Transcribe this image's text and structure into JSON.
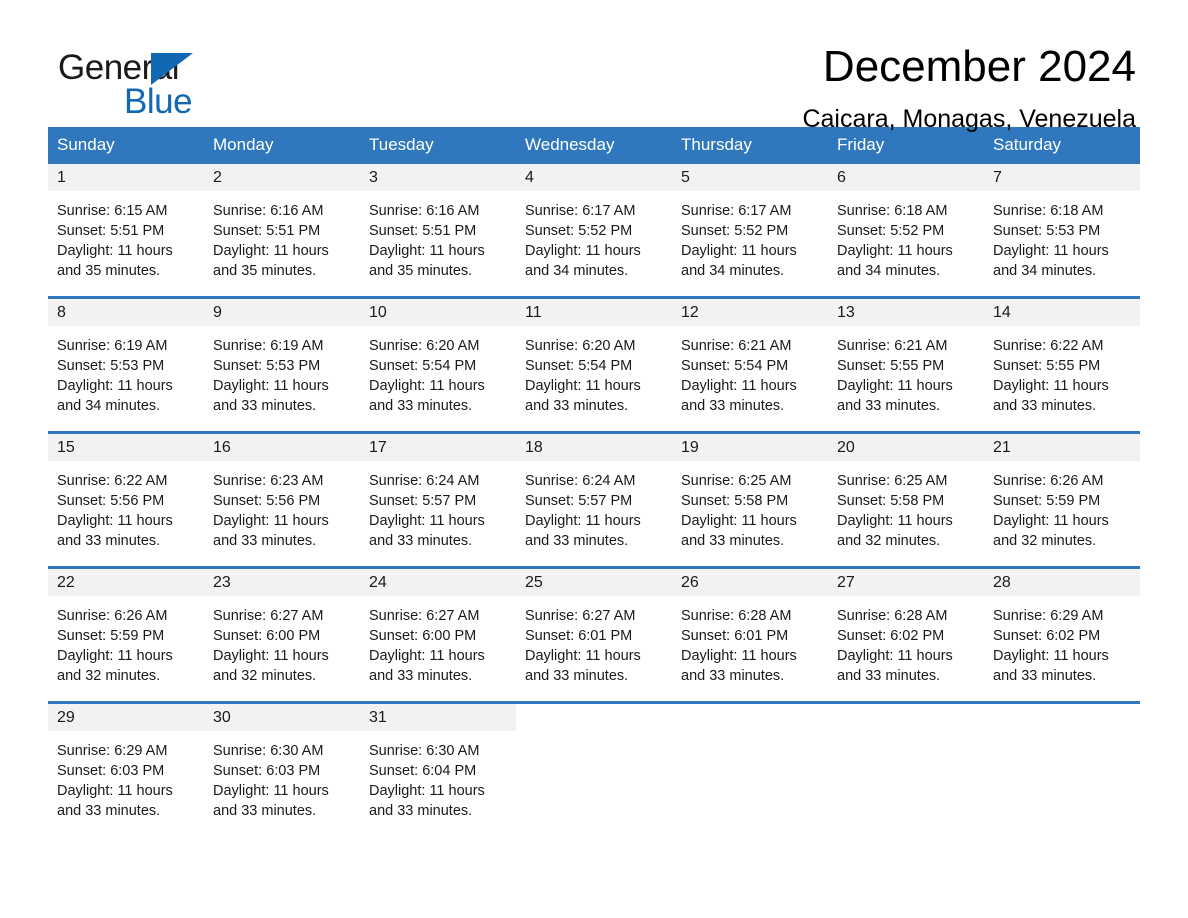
{
  "brand": {
    "name_part1": "General",
    "name_part2": "Blue",
    "triangle_icon": "triangle-icon",
    "accent_color": "#1268b3"
  },
  "header": {
    "title": "December 2024",
    "location": "Caicara, Monagas, Venezuela"
  },
  "theme": {
    "header_blue": "#2f78bd",
    "row_divider_blue": "#2f78bd",
    "daynum_band": "#f2f2f2",
    "page_background": "#ffffff"
  },
  "weekday_headers": [
    "Sunday",
    "Monday",
    "Tuesday",
    "Wednesday",
    "Thursday",
    "Friday",
    "Saturday"
  ],
  "weeks": [
    [
      {
        "day": "1",
        "sunrise": "Sunrise: 6:15 AM",
        "sunset": "Sunset: 5:51 PM",
        "daylight_line1": "Daylight: 11 hours",
        "daylight_line2": "and 35 minutes."
      },
      {
        "day": "2",
        "sunrise": "Sunrise: 6:16 AM",
        "sunset": "Sunset: 5:51 PM",
        "daylight_line1": "Daylight: 11 hours",
        "daylight_line2": "and 35 minutes."
      },
      {
        "day": "3",
        "sunrise": "Sunrise: 6:16 AM",
        "sunset": "Sunset: 5:51 PM",
        "daylight_line1": "Daylight: 11 hours",
        "daylight_line2": "and 35 minutes."
      },
      {
        "day": "4",
        "sunrise": "Sunrise: 6:17 AM",
        "sunset": "Sunset: 5:52 PM",
        "daylight_line1": "Daylight: 11 hours",
        "daylight_line2": "and 34 minutes."
      },
      {
        "day": "5",
        "sunrise": "Sunrise: 6:17 AM",
        "sunset": "Sunset: 5:52 PM",
        "daylight_line1": "Daylight: 11 hours",
        "daylight_line2": "and 34 minutes."
      },
      {
        "day": "6",
        "sunrise": "Sunrise: 6:18 AM",
        "sunset": "Sunset: 5:52 PM",
        "daylight_line1": "Daylight: 11 hours",
        "daylight_line2": "and 34 minutes."
      },
      {
        "day": "7",
        "sunrise": "Sunrise: 6:18 AM",
        "sunset": "Sunset: 5:53 PM",
        "daylight_line1": "Daylight: 11 hours",
        "daylight_line2": "and 34 minutes."
      }
    ],
    [
      {
        "day": "8",
        "sunrise": "Sunrise: 6:19 AM",
        "sunset": "Sunset: 5:53 PM",
        "daylight_line1": "Daylight: 11 hours",
        "daylight_line2": "and 34 minutes."
      },
      {
        "day": "9",
        "sunrise": "Sunrise: 6:19 AM",
        "sunset": "Sunset: 5:53 PM",
        "daylight_line1": "Daylight: 11 hours",
        "daylight_line2": "and 33 minutes."
      },
      {
        "day": "10",
        "sunrise": "Sunrise: 6:20 AM",
        "sunset": "Sunset: 5:54 PM",
        "daylight_line1": "Daylight: 11 hours",
        "daylight_line2": "and 33 minutes."
      },
      {
        "day": "11",
        "sunrise": "Sunrise: 6:20 AM",
        "sunset": "Sunset: 5:54 PM",
        "daylight_line1": "Daylight: 11 hours",
        "daylight_line2": "and 33 minutes."
      },
      {
        "day": "12",
        "sunrise": "Sunrise: 6:21 AM",
        "sunset": "Sunset: 5:54 PM",
        "daylight_line1": "Daylight: 11 hours",
        "daylight_line2": "and 33 minutes."
      },
      {
        "day": "13",
        "sunrise": "Sunrise: 6:21 AM",
        "sunset": "Sunset: 5:55 PM",
        "daylight_line1": "Daylight: 11 hours",
        "daylight_line2": "and 33 minutes."
      },
      {
        "day": "14",
        "sunrise": "Sunrise: 6:22 AM",
        "sunset": "Sunset: 5:55 PM",
        "daylight_line1": "Daylight: 11 hours",
        "daylight_line2": "and 33 minutes."
      }
    ],
    [
      {
        "day": "15",
        "sunrise": "Sunrise: 6:22 AM",
        "sunset": "Sunset: 5:56 PM",
        "daylight_line1": "Daylight: 11 hours",
        "daylight_line2": "and 33 minutes."
      },
      {
        "day": "16",
        "sunrise": "Sunrise: 6:23 AM",
        "sunset": "Sunset: 5:56 PM",
        "daylight_line1": "Daylight: 11 hours",
        "daylight_line2": "and 33 minutes."
      },
      {
        "day": "17",
        "sunrise": "Sunrise: 6:24 AM",
        "sunset": "Sunset: 5:57 PM",
        "daylight_line1": "Daylight: 11 hours",
        "daylight_line2": "and 33 minutes."
      },
      {
        "day": "18",
        "sunrise": "Sunrise: 6:24 AM",
        "sunset": "Sunset: 5:57 PM",
        "daylight_line1": "Daylight: 11 hours",
        "daylight_line2": "and 33 minutes."
      },
      {
        "day": "19",
        "sunrise": "Sunrise: 6:25 AM",
        "sunset": "Sunset: 5:58 PM",
        "daylight_line1": "Daylight: 11 hours",
        "daylight_line2": "and 33 minutes."
      },
      {
        "day": "20",
        "sunrise": "Sunrise: 6:25 AM",
        "sunset": "Sunset: 5:58 PM",
        "daylight_line1": "Daylight: 11 hours",
        "daylight_line2": "and 32 minutes."
      },
      {
        "day": "21",
        "sunrise": "Sunrise: 6:26 AM",
        "sunset": "Sunset: 5:59 PM",
        "daylight_line1": "Daylight: 11 hours",
        "daylight_line2": "and 32 minutes."
      }
    ],
    [
      {
        "day": "22",
        "sunrise": "Sunrise: 6:26 AM",
        "sunset": "Sunset: 5:59 PM",
        "daylight_line1": "Daylight: 11 hours",
        "daylight_line2": "and 32 minutes."
      },
      {
        "day": "23",
        "sunrise": "Sunrise: 6:27 AM",
        "sunset": "Sunset: 6:00 PM",
        "daylight_line1": "Daylight: 11 hours",
        "daylight_line2": "and 32 minutes."
      },
      {
        "day": "24",
        "sunrise": "Sunrise: 6:27 AM",
        "sunset": "Sunset: 6:00 PM",
        "daylight_line1": "Daylight: 11 hours",
        "daylight_line2": "and 33 minutes."
      },
      {
        "day": "25",
        "sunrise": "Sunrise: 6:27 AM",
        "sunset": "Sunset: 6:01 PM",
        "daylight_line1": "Daylight: 11 hours",
        "daylight_line2": "and 33 minutes."
      },
      {
        "day": "26",
        "sunrise": "Sunrise: 6:28 AM",
        "sunset": "Sunset: 6:01 PM",
        "daylight_line1": "Daylight: 11 hours",
        "daylight_line2": "and 33 minutes."
      },
      {
        "day": "27",
        "sunrise": "Sunrise: 6:28 AM",
        "sunset": "Sunset: 6:02 PM",
        "daylight_line1": "Daylight: 11 hours",
        "daylight_line2": "and 33 minutes."
      },
      {
        "day": "28",
        "sunrise": "Sunrise: 6:29 AM",
        "sunset": "Sunset: 6:02 PM",
        "daylight_line1": "Daylight: 11 hours",
        "daylight_line2": "and 33 minutes."
      }
    ],
    [
      {
        "day": "29",
        "sunrise": "Sunrise: 6:29 AM",
        "sunset": "Sunset: 6:03 PM",
        "daylight_line1": "Daylight: 11 hours",
        "daylight_line2": "and 33 minutes."
      },
      {
        "day": "30",
        "sunrise": "Sunrise: 6:30 AM",
        "sunset": "Sunset: 6:03 PM",
        "daylight_line1": "Daylight: 11 hours",
        "daylight_line2": "and 33 minutes."
      },
      {
        "day": "31",
        "sunrise": "Sunrise: 6:30 AM",
        "sunset": "Sunset: 6:04 PM",
        "daylight_line1": "Daylight: 11 hours",
        "daylight_line2": "and 33 minutes."
      },
      {
        "day": "",
        "sunrise": "",
        "sunset": "",
        "daylight_line1": "",
        "daylight_line2": ""
      },
      {
        "day": "",
        "sunrise": "",
        "sunset": "",
        "daylight_line1": "",
        "daylight_line2": ""
      },
      {
        "day": "",
        "sunrise": "",
        "sunset": "",
        "daylight_line1": "",
        "daylight_line2": ""
      },
      {
        "day": "",
        "sunrise": "",
        "sunset": "",
        "daylight_line1": "",
        "daylight_line2": ""
      }
    ]
  ]
}
